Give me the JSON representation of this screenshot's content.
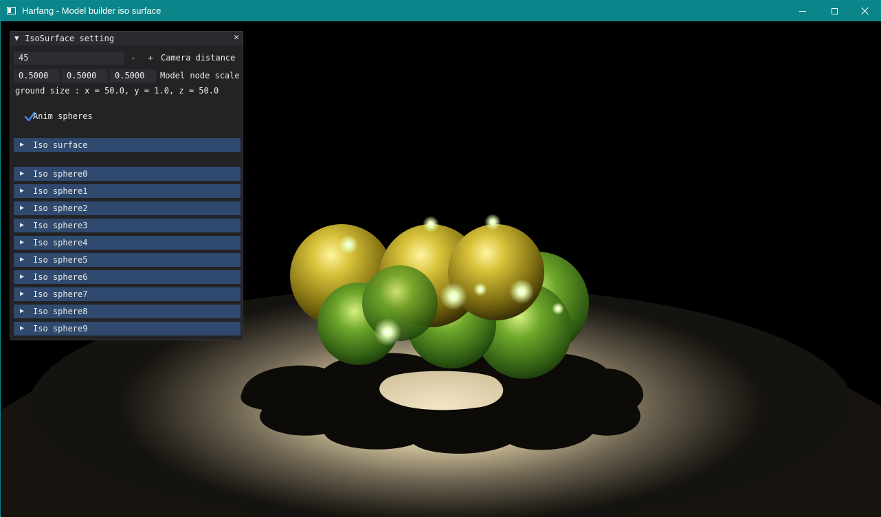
{
  "window": {
    "title": "Harfang - Model builder iso surface"
  },
  "panel": {
    "title": "IsoSurface setting",
    "collapse_glyph": "▼",
    "close_glyph": "✕",
    "camera": {
      "value": "45",
      "minus": "-",
      "plus": "+",
      "label": "Camera distance"
    },
    "scale": {
      "x": "0.5000",
      "y": "0.5000",
      "z": "0.5000",
      "label": "Model node scale"
    },
    "ground_text": "ground size : x = 50.0, y = 1.0, z = 50.0",
    "anim": {
      "checked": true,
      "label": "Anim spheres"
    },
    "tree_arrow": "▶",
    "iso_surface_label": "Iso surface",
    "spheres": [
      "Iso sphere0",
      "Iso sphere1",
      "Iso sphere2",
      "Iso sphere3",
      "Iso sphere4",
      "Iso sphere5",
      "Iso sphere6",
      "Iso sphere7",
      "Iso sphere8",
      "Iso sphere9"
    ]
  },
  "colors": {
    "titlebar": "#0b8589",
    "panel_bg": "#242428",
    "tree_header": "#2f4a6e",
    "checkmark": "#3d8df0",
    "sphere_gold": "#b9a52a",
    "sphere_green": "#4f8a22"
  },
  "icons": {
    "app": "app-window-icon",
    "minimize": "minimize-icon",
    "maximize": "maximize-icon",
    "close": "close-icon",
    "check": "checkmark-icon",
    "tree": "triangle-right-icon",
    "collapse": "triangle-down-icon"
  }
}
